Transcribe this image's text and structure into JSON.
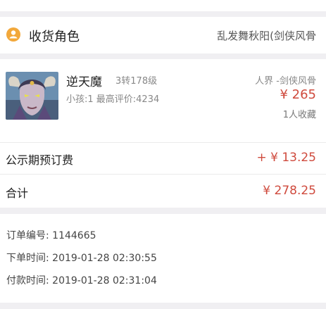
{
  "role": {
    "title": "收货角色",
    "value": "乱发舞秋阳(剑侠风骨"
  },
  "item": {
    "name": "逆天魔",
    "level": "3转178级",
    "info": "小孩:1 最高评价:4234",
    "server": "人界 -剑侠风骨",
    "price": "¥ 265",
    "favorites": "1人收藏"
  },
  "fees": {
    "public_period_fee_label": "公示期预订费",
    "public_period_fee_value": "+ ¥ 13.25",
    "total_label": "合计",
    "total_value": "¥ 278.25"
  },
  "order": {
    "order_number": "订单编号: 1144665",
    "order_time": "下单时间: 2019-01-28 02:30:55",
    "payment_time": "付款时间: 2019-01-28 02:31:04"
  },
  "colors": {
    "accent_price": "#cf4a3d",
    "role_icon": "#f2a83b",
    "background": "#f0eff2"
  }
}
